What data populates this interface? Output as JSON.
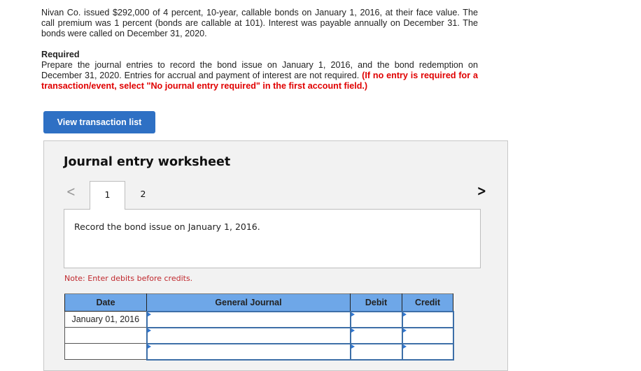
{
  "problem": {
    "paragraph": "Nivan Co. issued $292,000 of 4 percent, 10-year, callable bonds on January 1, 2016, at their face value. The call premium was 1 percent (bonds are callable at 101). Interest was payable annually on December 31. The bonds were called on December 31, 2020.",
    "required_heading": "Required",
    "required_text": "Prepare the journal entries to record the bond issue on January 1, 2016, and the bond redemption on December 31, 2020. Entries for accrual and payment of interest are not required.",
    "required_instruction": "(If no entry is required for a transaction/event, select \"No journal entry required\" in the first account field.)"
  },
  "buttons": {
    "view_transaction_list": "View transaction list"
  },
  "worksheet": {
    "title": "Journal entry worksheet",
    "prev_icon": "chevron-left-icon",
    "next_icon": "chevron-right-icon",
    "tabs": [
      {
        "label": "1",
        "active": true
      },
      {
        "label": "2",
        "active": false
      }
    ],
    "description": "Record the bond issue on January 1, 2016.",
    "note": "Note: Enter debits before credits.",
    "table": {
      "headers": [
        "Date",
        "General Journal",
        "Debit",
        "Credit"
      ],
      "rows": [
        {
          "date": "January 01, 2016",
          "account": "",
          "debit": "",
          "credit": ""
        },
        {
          "date": "",
          "account": "",
          "debit": "",
          "credit": ""
        },
        {
          "date": "",
          "account": "",
          "debit": "",
          "credit": ""
        }
      ]
    }
  },
  "colors": {
    "button_blue": "#2e70c4",
    "header_blue": "#6ea7e8",
    "instruction_red": "#e00000",
    "note_red": "#c0282d"
  }
}
